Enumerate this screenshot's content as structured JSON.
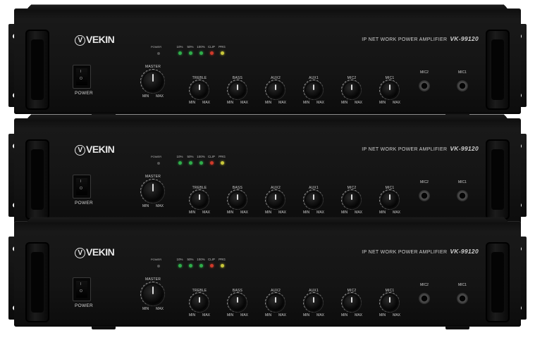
{
  "units": [
    {
      "brand": "VEKIN",
      "model_prefix": "IP NET WORK POWER AMPLIFIER",
      "model": "VK-99120",
      "power_switch_label": "POWER",
      "switch_on": "I",
      "switch_off": "O",
      "power_led_label": "POWER",
      "meters": [
        {
          "label": "10%",
          "color": "#2fae4a"
        },
        {
          "label": "50%",
          "color": "#2fae4a"
        },
        {
          "label": "100%",
          "color": "#2fae4a"
        },
        {
          "label": "CLIP",
          "color": "#d03a2a"
        },
        {
          "label": "PRG",
          "color": "#c9c83a"
        }
      ],
      "knobs": [
        {
          "label": "MASTER",
          "min": "MIN",
          "max": "MAX"
        },
        {
          "label": "TREBLE",
          "min": "MIN",
          "max": "MAX"
        },
        {
          "label": "BASS",
          "min": "MIN",
          "max": "MAX"
        },
        {
          "label": "AUX2",
          "min": "MIN",
          "max": "MAX"
        },
        {
          "label": "AUX1",
          "min": "MIN",
          "max": "MAX"
        },
        {
          "label": "MIC2",
          "min": "MIN",
          "max": "MAX"
        },
        {
          "label": "MIC1",
          "min": "MIN",
          "max": "MAX"
        }
      ],
      "jacks": [
        {
          "label": "MIC2"
        },
        {
          "label": "MIC1"
        }
      ]
    },
    {
      "brand": "VEKIN",
      "model_prefix": "IP NET WORK POWER AMPLIFIER",
      "model": "VK-99120",
      "power_switch_label": "POWER",
      "switch_on": "I",
      "switch_off": "O",
      "power_led_label": "POWER",
      "meters": [
        {
          "label": "10%",
          "color": "#2fae4a"
        },
        {
          "label": "50%",
          "color": "#2fae4a"
        },
        {
          "label": "100%",
          "color": "#2fae4a"
        },
        {
          "label": "CLIP",
          "color": "#d03a2a"
        },
        {
          "label": "PRG",
          "color": "#c9c83a"
        }
      ],
      "knobs": [
        {
          "label": "MASTER",
          "min": "MIN",
          "max": "MAX"
        },
        {
          "label": "TREBLE",
          "min": "MIN",
          "max": "MAX"
        },
        {
          "label": "BASS",
          "min": "MIN",
          "max": "MAX"
        },
        {
          "label": "AUX2",
          "min": "MIN",
          "max": "MAX"
        },
        {
          "label": "AUX1",
          "min": "MIN",
          "max": "MAX"
        },
        {
          "label": "MIC2",
          "min": "MIN",
          "max": "MAX"
        },
        {
          "label": "MIC1",
          "min": "MIN",
          "max": "MAX"
        }
      ],
      "jacks": [
        {
          "label": "MIC2"
        },
        {
          "label": "MIC1"
        }
      ]
    },
    {
      "brand": "VEKIN",
      "model_prefix": "IP NET WORK POWER AMPLIFIER",
      "model": "VK-99120",
      "power_switch_label": "POWER",
      "switch_on": "I",
      "switch_off": "O",
      "power_led_label": "POWER",
      "meters": [
        {
          "label": "10%",
          "color": "#2fae4a"
        },
        {
          "label": "50%",
          "color": "#2fae4a"
        },
        {
          "label": "100%",
          "color": "#2fae4a"
        },
        {
          "label": "CLIP",
          "color": "#d03a2a"
        },
        {
          "label": "PRG",
          "color": "#c9c83a"
        }
      ],
      "knobs": [
        {
          "label": "MASTER",
          "min": "MIN",
          "max": "MAX"
        },
        {
          "label": "TREBLE",
          "min": "MIN",
          "max": "MAX"
        },
        {
          "label": "BASS",
          "min": "MIN",
          "max": "MAX"
        },
        {
          "label": "AUX2",
          "min": "MIN",
          "max": "MAX"
        },
        {
          "label": "AUX1",
          "min": "MIN",
          "max": "MAX"
        },
        {
          "label": "MIC2",
          "min": "MIN",
          "max": "MAX"
        },
        {
          "label": "MIC1",
          "min": "MIN",
          "max": "MAX"
        }
      ],
      "jacks": [
        {
          "label": "MIC2"
        },
        {
          "label": "MIC1"
        }
      ]
    }
  ]
}
